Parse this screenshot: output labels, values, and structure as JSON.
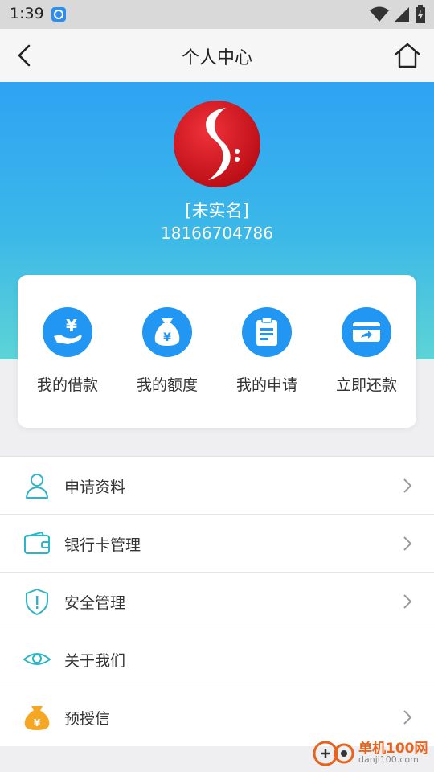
{
  "status_bar": {
    "time": "1:39"
  },
  "navbar": {
    "title": "个人中心"
  },
  "profile": {
    "name": "[未实名]",
    "phone": "18166704786"
  },
  "quick_actions": [
    {
      "label": "我的借款",
      "icon": "hand-yen-icon"
    },
    {
      "label": "我的额度",
      "icon": "money-bag-icon"
    },
    {
      "label": "我的申请",
      "icon": "clipboard-icon"
    },
    {
      "label": "立即还款",
      "icon": "card-repay-icon"
    }
  ],
  "menu": [
    {
      "label": "申请资料",
      "icon": "user-icon",
      "has_arrow": true
    },
    {
      "label": "银行卡管理",
      "icon": "wallet-icon",
      "has_arrow": true
    },
    {
      "label": "安全管理",
      "icon": "shield-icon",
      "has_arrow": true
    },
    {
      "label": "关于我们",
      "icon": "eye-icon",
      "has_arrow": false
    },
    {
      "label": "预授信",
      "icon": "money-bag-icon",
      "has_arrow": true
    }
  ],
  "watermark": {
    "name": "单机100网",
    "domain": "danji100.com"
  },
  "colors": {
    "accent": "#2196f3",
    "hero_top": "#2ea3f3",
    "hero_bottom": "#5dd4d6",
    "logo_red": "#d8131e",
    "menu_icon_teal": "#2bb5c8",
    "menu_icon_orange": "#f5a623"
  }
}
